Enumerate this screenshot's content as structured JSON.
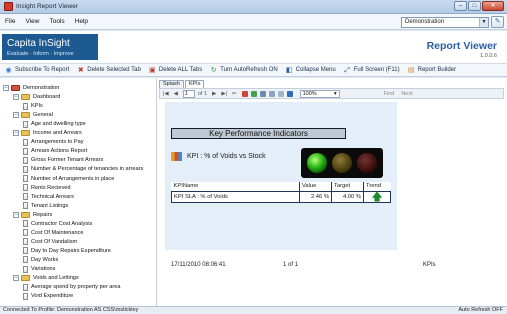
{
  "window": {
    "title": "Insight Report Viewer"
  },
  "menu": [
    {
      "label": "File"
    },
    {
      "label": "View"
    },
    {
      "label": "Tools"
    },
    {
      "label": "Help"
    }
  ],
  "profile_select": {
    "value": "Demonstration"
  },
  "brand": {
    "name": "Capita InSight",
    "tagline": "Evaluate · Inform · Improve",
    "product": "Report Viewer",
    "version": "1.0.0.6"
  },
  "toolbar": [
    {
      "label": "Subscribe To Report",
      "icon": "subscribe-icon"
    },
    {
      "label": "Delete Selected Tab",
      "icon": "delete-tab-icon"
    },
    {
      "label": "Delete ALL Tabs",
      "icon": "delete-all-tabs-icon"
    },
    {
      "label": "Turn AutoRefresh ON",
      "icon": "refresh-icon"
    },
    {
      "label": "Collapse Menu",
      "icon": "collapse-icon"
    },
    {
      "label": "Full Screen (F11)",
      "icon": "fullscreen-icon"
    },
    {
      "label": "Report Builder",
      "icon": "report-builder-icon"
    }
  ],
  "tree": [
    {
      "label": "Demonstration",
      "level": 0,
      "kind": "root",
      "expanded": true
    },
    {
      "label": "Dashboard",
      "level": 1,
      "kind": "folder",
      "expanded": true
    },
    {
      "label": "KPIs",
      "level": 2,
      "kind": "page"
    },
    {
      "label": "General",
      "level": 1,
      "kind": "folder",
      "expanded": true
    },
    {
      "label": "Age and dwelling type",
      "level": 2,
      "kind": "page"
    },
    {
      "label": "Income and Arrears",
      "level": 1,
      "kind": "folder",
      "expanded": true
    },
    {
      "label": "Arrangements to Pay",
      "level": 2,
      "kind": "page"
    },
    {
      "label": "Arrears Actions Report",
      "level": 2,
      "kind": "page"
    },
    {
      "label": "Gross Former Tenant Arrears",
      "level": 2,
      "kind": "page"
    },
    {
      "label": "Number & Percentage of tenancies in arrears",
      "level": 2,
      "kind": "page"
    },
    {
      "label": "Number of Arrangements in place",
      "level": 2,
      "kind": "page"
    },
    {
      "label": "Rents Recieved",
      "level": 2,
      "kind": "page"
    },
    {
      "label": "Technical Arrears",
      "level": 2,
      "kind": "page"
    },
    {
      "label": "Tenant Listings",
      "level": 2,
      "kind": "page"
    },
    {
      "label": "Repairs",
      "level": 1,
      "kind": "folder",
      "expanded": true
    },
    {
      "label": "Contractor Cost Analysis",
      "level": 2,
      "kind": "page"
    },
    {
      "label": "Cost Of Maintenance",
      "level": 2,
      "kind": "page"
    },
    {
      "label": "Cost Of Vandalism",
      "level": 2,
      "kind": "page"
    },
    {
      "label": "Day to Day Repairs Expenditure",
      "level": 2,
      "kind": "page"
    },
    {
      "label": "Day Works",
      "level": 2,
      "kind": "page"
    },
    {
      "label": "Variations",
      "level": 2,
      "kind": "page"
    },
    {
      "label": "Voids and Lettings",
      "level": 1,
      "kind": "folder",
      "expanded": true
    },
    {
      "label": "Average spend by property per area",
      "level": 2,
      "kind": "page"
    },
    {
      "label": "Void Expenditure",
      "level": 2,
      "kind": "page"
    }
  ],
  "viewer": {
    "tabs": [
      {
        "label": "Splash"
      },
      {
        "label": "KPIs",
        "active": true
      }
    ],
    "page_current": "1",
    "page_of": "of 1",
    "zoom": "100%",
    "find": "Find",
    "next": "Next"
  },
  "report": {
    "banner": "Key Performance Indicators",
    "kpi_label": "KPI : % of Voids vs Stock",
    "traffic_light": "green",
    "table": {
      "headers": [
        "KPIName",
        "Value",
        "Target",
        "Trend"
      ],
      "rows": [
        {
          "name": "KPI SLA : % of Voids",
          "value": "2.46 %",
          "target": "4.00 %",
          "trend": "up"
        }
      ]
    },
    "footer": {
      "timestamp": "17/11/2010 08:06:41",
      "page": "1 of 1",
      "report_name": "KPIs"
    }
  },
  "status": {
    "left": "Connected To Profile: Demonstration AS CSS\\mstickley",
    "right": "Auto Refresh OFF"
  },
  "colors": {
    "brand_blue": "#1d5a91",
    "accent_title": "#2a5fa3",
    "trend_green": "#1a8a2a"
  }
}
